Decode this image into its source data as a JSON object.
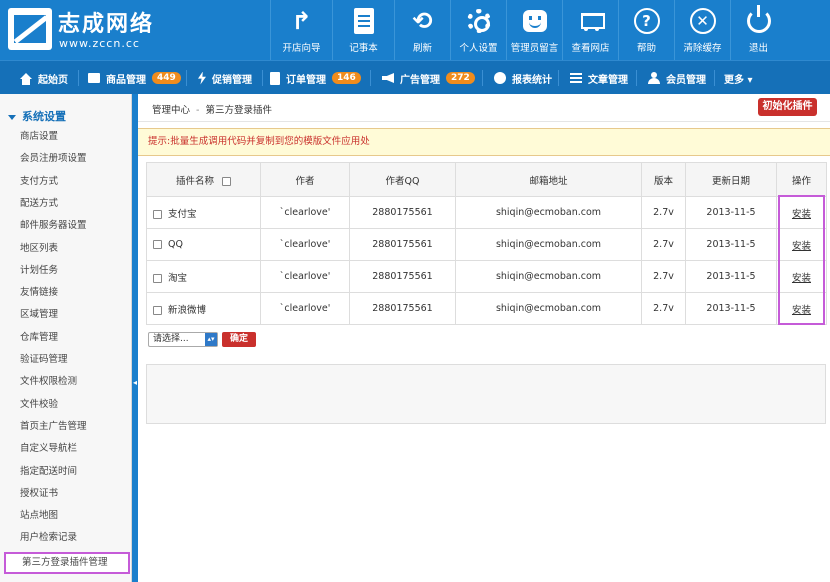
{
  "brand": {
    "title": "志成网络",
    "url": "www.zccn.cc"
  },
  "topnav": [
    {
      "label": "开店向导",
      "icon": "share-arrow-icon",
      "glyph": "↱"
    },
    {
      "label": "记事本",
      "icon": "notebook-icon"
    },
    {
      "label": "刷新",
      "icon": "refresh-icon",
      "glyph": "⟲"
    },
    {
      "label": "个人设置",
      "icon": "gear-icon"
    },
    {
      "label": "管理员留言",
      "icon": "message-icon"
    },
    {
      "label": "查看网店",
      "icon": "cart-icon"
    },
    {
      "label": "帮助",
      "icon": "help-icon",
      "glyph": "?"
    },
    {
      "label": "清除缓存",
      "icon": "clear-icon",
      "glyph": "✕"
    },
    {
      "label": "退出",
      "icon": "power-icon"
    }
  ],
  "navbar": [
    {
      "label": "起始页",
      "icon": "home-icon"
    },
    {
      "label": "商品管理",
      "icon": "folder-icon",
      "badge": "449"
    },
    {
      "label": "促销管理",
      "icon": "bolt-icon"
    },
    {
      "label": "订单管理",
      "icon": "clipboard-icon",
      "badge": "146"
    },
    {
      "label": "广告管理",
      "icon": "megaphone-icon",
      "badge": "272"
    },
    {
      "label": "报表统计",
      "icon": "pie-chart-icon"
    },
    {
      "label": "文章管理",
      "icon": "list-icon"
    },
    {
      "label": "会员管理",
      "icon": "user-icon"
    },
    {
      "label": "更多 ▾",
      "icon": ""
    }
  ],
  "sidebar": {
    "section": "系统设置",
    "items": [
      "商店设置",
      "会员注册项设置",
      "支付方式",
      "配送方式",
      "邮件服务器设置",
      "地区列表",
      "计划任务",
      "友情链接",
      "区域管理",
      "仓库管理",
      "验证码管理",
      "文件权限检测",
      "文件校验",
      "首页主广告管理",
      "自定义导航栏",
      "指定配送时间",
      "授权证书",
      "站点地图",
      "用户检索记录",
      "第三方登录插件管理"
    ],
    "active_index": 19
  },
  "breadcrumb": {
    "root": "管理中心",
    "sep": "-",
    "current": "第三方登录插件"
  },
  "init_button": "初始化插件",
  "tip": "提示:批量生成调用代码并复制到您的模版文件应用处",
  "table": {
    "headers": [
      "插件名称",
      "作者",
      "作者QQ",
      "邮箱地址",
      "版本",
      "更新日期",
      "操作"
    ],
    "rows": [
      {
        "name": "支付宝",
        "author": "`clearlove'",
        "qq": "2880175561",
        "email": "shiqin@ecmoban.com",
        "version": "2.7v",
        "date": "2013-11-5",
        "action": "安装"
      },
      {
        "name": "QQ",
        "author": "`clearlove'",
        "qq": "2880175561",
        "email": "shiqin@ecmoban.com",
        "version": "2.7v",
        "date": "2013-11-5",
        "action": "安装"
      },
      {
        "name": "淘宝",
        "author": "`clearlove'",
        "qq": "2880175561",
        "email": "shiqin@ecmoban.com",
        "version": "2.7v",
        "date": "2013-11-5",
        "action": "安装"
      },
      {
        "name": "新浪微博",
        "author": "`clearlove'",
        "qq": "2880175561",
        "email": "shiqin@ecmoban.com",
        "version": "2.7v",
        "date": "2013-11-5",
        "action": "安装"
      }
    ]
  },
  "batch": {
    "select_value": "请选择...",
    "confirm": "确定"
  },
  "colors": {
    "header": "#1a7fcc",
    "navbar": "#1570b8",
    "badge": "#f08c1d",
    "danger": "#c9302c",
    "highlight": "#c55bd8"
  }
}
